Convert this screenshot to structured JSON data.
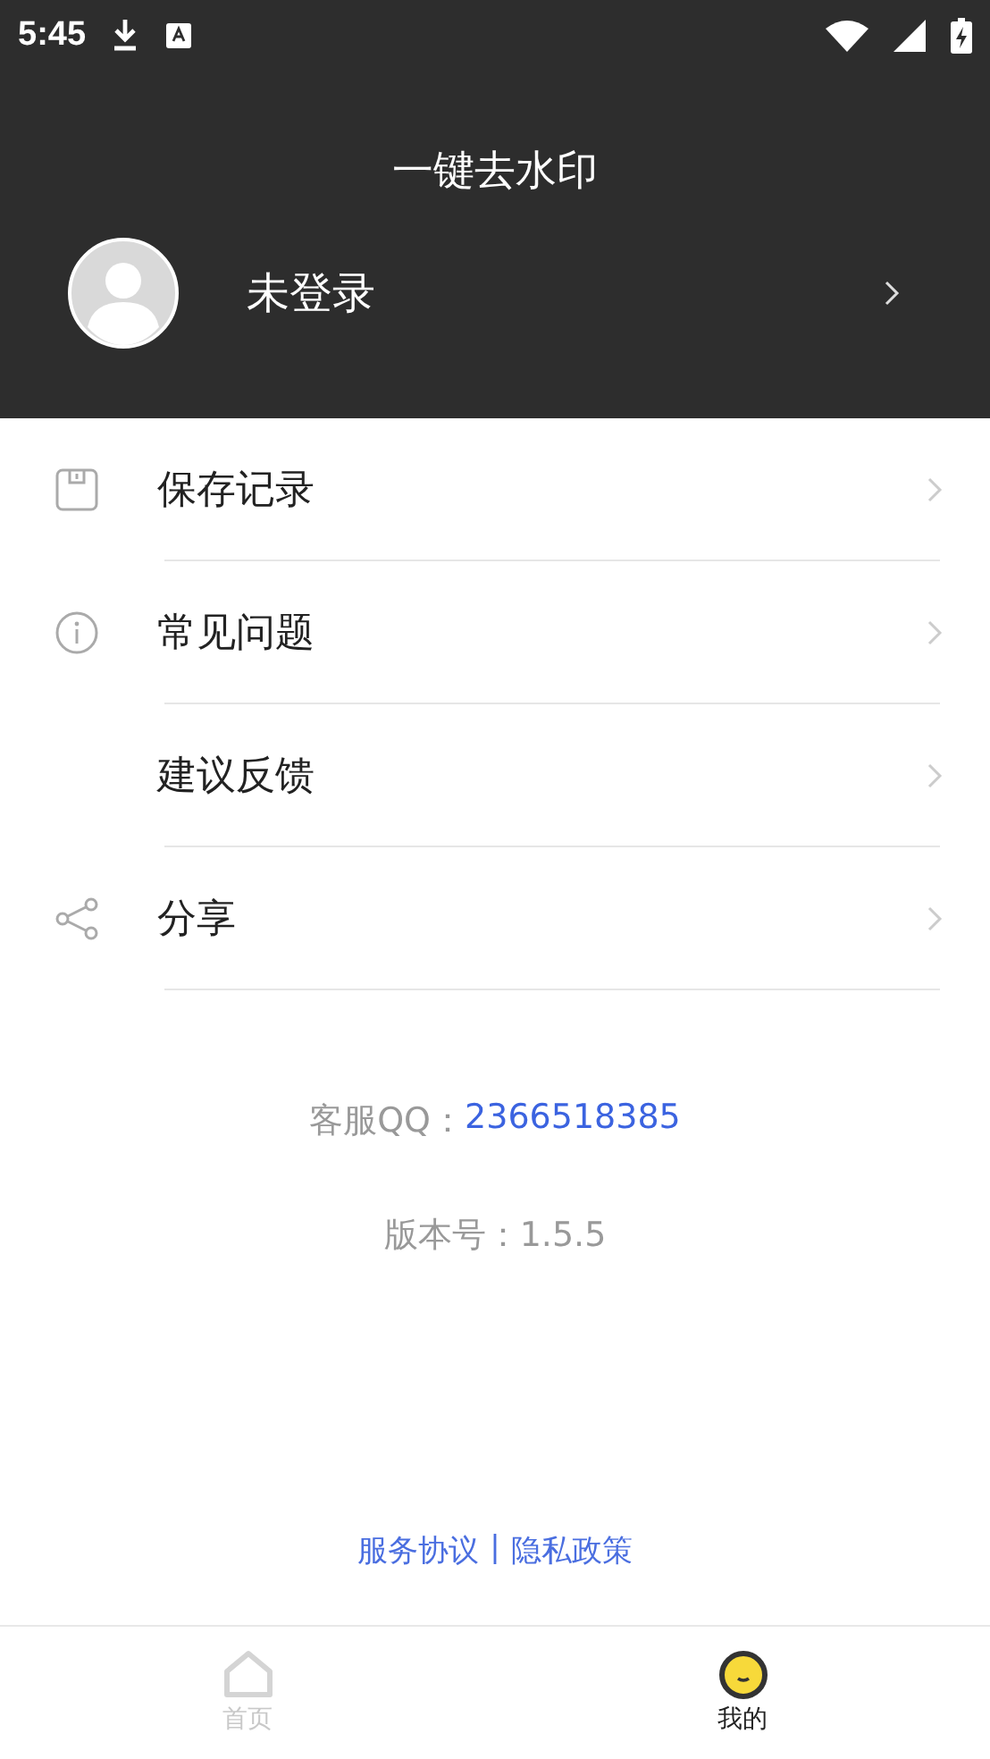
{
  "status_bar": {
    "time": "5:45"
  },
  "header": {
    "title": "一键去水印",
    "profile": {
      "name": "未登录"
    }
  },
  "menu": [
    {
      "label": "保存记录",
      "kind": "save"
    },
    {
      "label": "常见问题",
      "kind": "info"
    },
    {
      "label": "建议反馈",
      "kind": "plain"
    },
    {
      "label": "分享",
      "kind": "share"
    }
  ],
  "contact": {
    "label": "客服QQ：",
    "value": "2366518385"
  },
  "version": "版本号：1.5.5",
  "links": [
    "服务协议",
    "|",
    "隐私政策"
  ],
  "tabs": [
    {
      "label": "首页",
      "selected": false
    },
    {
      "label": "我的",
      "selected": true
    }
  ]
}
